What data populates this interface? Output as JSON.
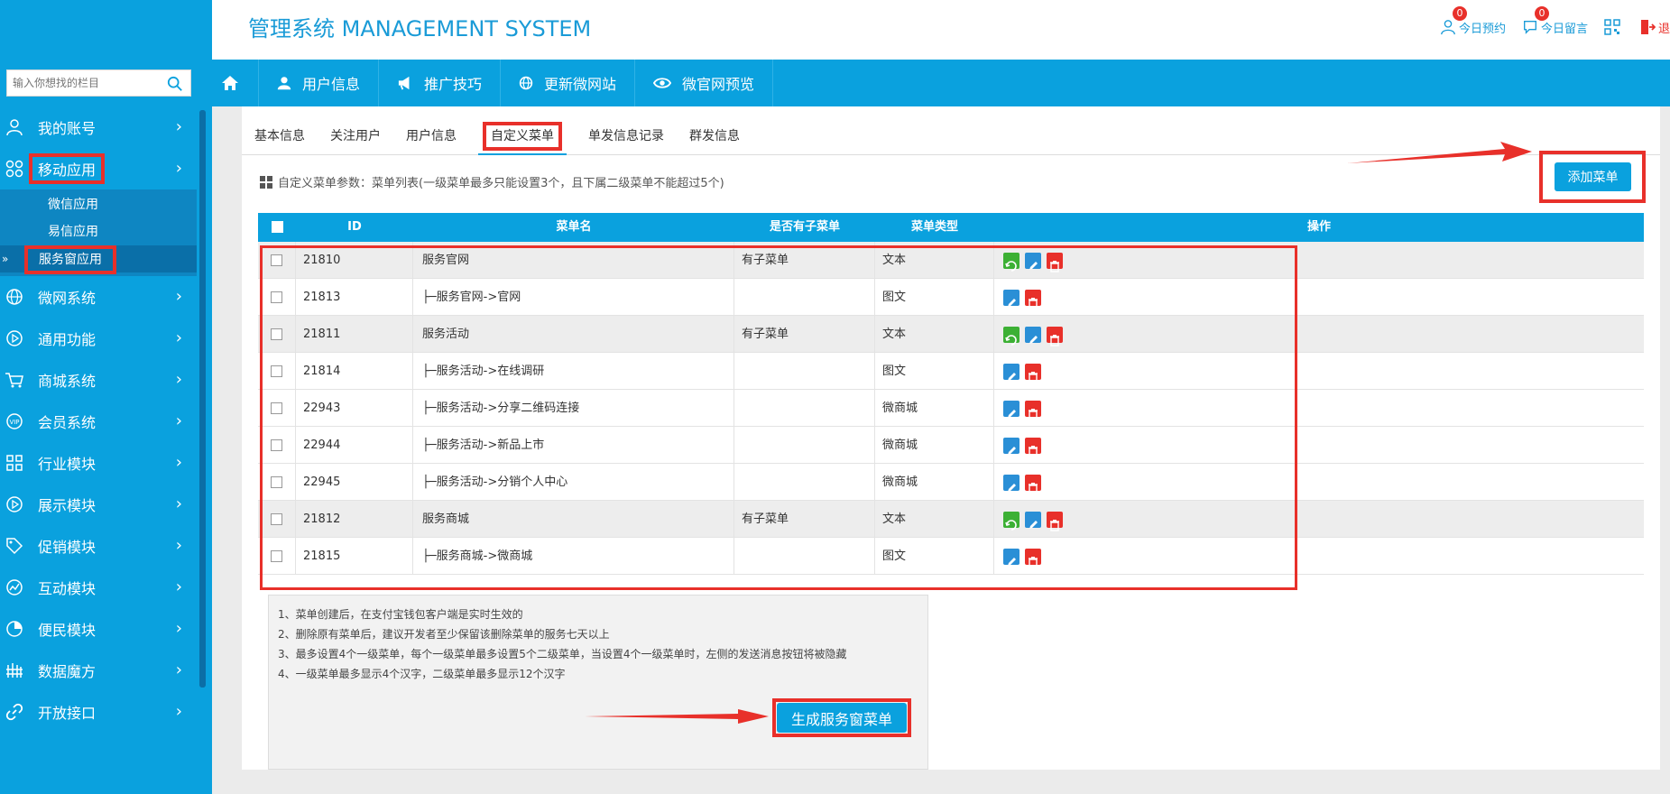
{
  "app": {
    "title": "管理系统 MANAGEMENT SYSTEM"
  },
  "header": {
    "tools": [
      {
        "label": "今日预约",
        "badge": "0",
        "icon": "user-icon"
      },
      {
        "label": "今日留言",
        "badge": "0",
        "icon": "message-icon"
      },
      {
        "label": "",
        "icon": "qrcode-icon"
      },
      {
        "label": "退",
        "icon": "logout-icon"
      }
    ]
  },
  "sidebar": {
    "search_placeholder": "输入你想找的栏目",
    "items": [
      {
        "label": "我的账号",
        "icon": "user-icon"
      },
      {
        "label": "移动应用",
        "icon": "apps-icon",
        "active": true,
        "children": [
          {
            "label": "微信应用"
          },
          {
            "label": "易信应用"
          },
          {
            "label": "服务窗应用",
            "active": true
          }
        ]
      },
      {
        "label": "微网系统",
        "icon": "globe-icon"
      },
      {
        "label": "通用功能",
        "icon": "play-icon"
      },
      {
        "label": "商城系统",
        "icon": "cart-icon"
      },
      {
        "label": "会员系统",
        "icon": "vip-icon"
      },
      {
        "label": "行业模块",
        "icon": "grid-icon"
      },
      {
        "label": "展示模块",
        "icon": "play-icon"
      },
      {
        "label": "促销模块",
        "icon": "tag-icon"
      },
      {
        "label": "互动模块",
        "icon": "chart-icon"
      },
      {
        "label": "便民模块",
        "icon": "pie-icon"
      },
      {
        "label": "数据魔方",
        "icon": "cube-icon"
      },
      {
        "label": "开放接口",
        "icon": "link-icon"
      }
    ]
  },
  "topnav": {
    "items": [
      {
        "label": "用户信息",
        "icon": "user-icon"
      },
      {
        "label": "推广技巧",
        "icon": "megaphone-icon"
      },
      {
        "label": "更新微网站",
        "icon": "globe-icon"
      },
      {
        "label": "微官网预览",
        "icon": "eye-icon"
      }
    ]
  },
  "tabs": [
    {
      "label": "基本信息"
    },
    {
      "label": "关注用户"
    },
    {
      "label": "用户信息"
    },
    {
      "label": "自定义菜单",
      "active": true
    },
    {
      "label": "单发信息记录"
    },
    {
      "label": "群发信息"
    }
  ],
  "info_line": "自定义菜单参数：菜单列表(一级菜单最多只能设置3个，且下属二级菜单不能超过5个)",
  "add_button": "添加菜单",
  "table": {
    "headers": [
      "ID",
      "菜单名",
      "是否有子菜单",
      "菜单类型",
      "操作"
    ],
    "rows": [
      {
        "id": "21810",
        "name": "服务官网",
        "has_sub": "有子菜单",
        "type": "文本",
        "parent": true
      },
      {
        "id": "21813",
        "name": "├─服务官网->官网",
        "has_sub": "",
        "type": "图文",
        "parent": false
      },
      {
        "id": "21811",
        "name": "服务活动",
        "has_sub": "有子菜单",
        "type": "文本",
        "parent": true
      },
      {
        "id": "21814",
        "name": "├─服务活动->在线调研",
        "has_sub": "",
        "type": "图文",
        "parent": false
      },
      {
        "id": "22943",
        "name": "├─服务活动->分享二维码连接",
        "has_sub": "",
        "type": "微商城",
        "parent": false
      },
      {
        "id": "22944",
        "name": "├─服务活动->新品上市",
        "has_sub": "",
        "type": "微商城",
        "parent": false
      },
      {
        "id": "22945",
        "name": "├─服务活动->分销个人中心",
        "has_sub": "",
        "type": "微商城",
        "parent": false
      },
      {
        "id": "21812",
        "name": "服务商城",
        "has_sub": "有子菜单",
        "type": "文本",
        "parent": true
      },
      {
        "id": "21815",
        "name": "├─服务商城->微商城",
        "has_sub": "",
        "type": "图文",
        "parent": false
      }
    ]
  },
  "notes": [
    "1、菜单创建后，在支付宝钱包客户端是实时生效的",
    "2、删除原有菜单后，建议开发者至少保留该删除菜单的服务七天以上",
    "3、最多设置4个一级菜单，每个一级菜单最多设置5个二级菜单，当设置4个一级菜单时，左侧的发送消息按钮将被隐藏",
    "4、一级菜单最多显示4个汉字，二级菜单最多显示12个汉字"
  ],
  "generate_button": "生成服务窗菜单",
  "colors": {
    "accent": "#0aa1de",
    "highlight": "#e8302a"
  }
}
